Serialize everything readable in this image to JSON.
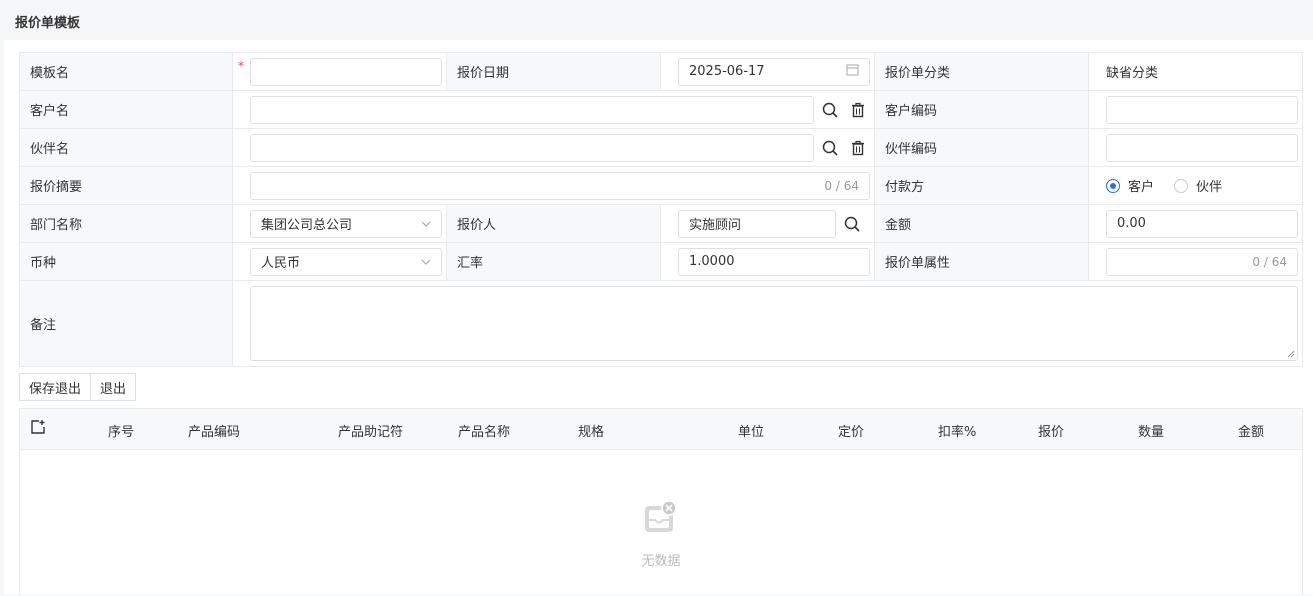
{
  "page": {
    "title": "报价单模板"
  },
  "form": {
    "template_name_label": "模板名",
    "template_name_value": "",
    "quote_date_label": "报价日期",
    "quote_date_value": "2025-06-17",
    "category_label": "报价单分类",
    "category_value": "缺省分类",
    "customer_name_label": "客户名",
    "customer_name_value": "",
    "customer_code_label": "客户编码",
    "customer_code_value": "",
    "partner_name_label": "伙伴名",
    "partner_name_value": "",
    "partner_code_label": "伙伴编码",
    "partner_code_value": "",
    "summary_label": "报价摘要",
    "summary_counter": "0 / 64",
    "payer_label": "付款方",
    "payer_options": [
      "客户",
      "伙伴"
    ],
    "payer_selected": "客户",
    "department_label": "部门名称",
    "department_value": "集团公司总公司",
    "quoter_label": "报价人",
    "quoter_value": "实施顾问",
    "amount_label": "金额",
    "amount_value": "0.00",
    "currency_label": "币种",
    "currency_value": "人民币",
    "rate_label": "汇率",
    "rate_value": "1.0000",
    "attribute_label": "报价单属性",
    "attribute_counter": "0 / 64",
    "remark_label": "备注",
    "remark_value": "",
    "required_mark": "*"
  },
  "actions": {
    "save_exit": "保存退出",
    "exit": "退出"
  },
  "grid": {
    "columns": [
      "序号",
      "产品编码",
      "产品助记符",
      "产品名称",
      "规格",
      "单位",
      "定价",
      "扣率%",
      "报价",
      "数量",
      "金额"
    ],
    "empty_text": "无数据"
  },
  "colors": {
    "accent": "#2a6fdb",
    "required": "#e54545"
  },
  "icons": {
    "date": "calendar-icon",
    "search": "search-icon",
    "delete": "trash-icon",
    "select": "chevron-down-icon",
    "add_row": "add-row-icon",
    "empty": "empty-box-icon"
  }
}
